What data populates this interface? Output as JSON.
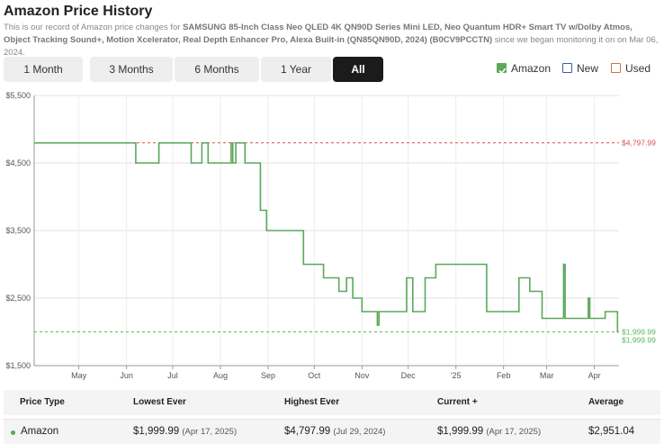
{
  "header": {
    "title": "Amazon Price History",
    "desc_prefix": "This is our record of Amazon price changes for ",
    "product_name": "SAMSUNG 85-Inch Class Neo QLED 4K QN90D Series Mini LED, Neo Quantum HDR+ Smart TV w/Dolby Atmos, Object Tracking Sound+, Motion Xcelerator, Real Depth Enhancer Pro, Alexa Built-in (QN85QN90D, 2024) (B0CV9PCCTN)",
    "desc_suffix": " since we began monitoring it on on Mar 06, 2024."
  },
  "tabs": [
    {
      "label": "1 Month",
      "active": false
    },
    {
      "label": "3 Months",
      "active": false
    },
    {
      "label": "6 Months",
      "active": false
    },
    {
      "label": "1 Year",
      "active": false
    },
    {
      "label": "All",
      "active": true
    }
  ],
  "legend": [
    {
      "label": "Amazon",
      "checked": true,
      "color": "#5ba85b"
    },
    {
      "label": "New",
      "checked": false,
      "color": "#3a5fb0"
    },
    {
      "label": "Used",
      "checked": false,
      "color": "#c8784a"
    }
  ],
  "chart_data": {
    "type": "line",
    "title": "",
    "xlabel": "",
    "ylabel": "",
    "ylim": [
      1500,
      5500
    ],
    "y_ticks": [
      "$1,500",
      "$2,500",
      "$3,500",
      "$4,500",
      "$5,500"
    ],
    "y_tick_values": [
      1500,
      2500,
      3500,
      4500,
      5500
    ],
    "x_ticks": [
      "May",
      "Jun",
      "Jul",
      "Aug",
      "Sep",
      "Oct",
      "Nov",
      "Dec",
      "'25",
      "Feb",
      "Mar",
      "Apr"
    ],
    "x_tick_values": [
      "2024-05-01",
      "2024-06-01",
      "2024-07-01",
      "2024-08-01",
      "2024-09-01",
      "2024-10-01",
      "2024-11-01",
      "2024-12-01",
      "2025-01-01",
      "2025-02-01",
      "2025-03-01",
      "2025-04-01"
    ],
    "x_range": [
      "2024-04-02",
      "2025-04-17"
    ],
    "grid": true,
    "highest_line": {
      "value": 4797.99,
      "label": "$4,797.99",
      "color": "#d9534f"
    },
    "lowest_line": {
      "value": 1999.99,
      "label": "$1,999.99",
      "color": "#5cb85c"
    },
    "current_label": "$1,999.99",
    "series": [
      {
        "name": "Amazon",
        "color": "#5ba85b",
        "step": true,
        "points": [
          [
            "2024-04-02",
            4797.99
          ],
          [
            "2024-06-07",
            4499.99
          ],
          [
            "2024-06-22",
            4797.99
          ],
          [
            "2024-07-13",
            4499.99
          ],
          [
            "2024-07-20",
            4797.99
          ],
          [
            "2024-07-24",
            4499.99
          ],
          [
            "2024-08-08",
            4797.99
          ],
          [
            "2024-08-09",
            4499.99
          ],
          [
            "2024-08-11",
            4797.99
          ],
          [
            "2024-08-17",
            4499.99
          ],
          [
            "2024-08-27",
            3799.99
          ],
          [
            "2024-08-31",
            3499.99
          ],
          [
            "2024-09-24",
            2999.99
          ],
          [
            "2024-10-07",
            2799.99
          ],
          [
            "2024-10-17",
            2599.99
          ],
          [
            "2024-10-22",
            2799.99
          ],
          [
            "2024-10-26",
            2499.99
          ],
          [
            "2024-11-01",
            2299.99
          ],
          [
            "2024-11-11",
            2099.99
          ],
          [
            "2024-11-12",
            2299.99
          ],
          [
            "2024-11-30",
            2799.99
          ],
          [
            "2024-12-04",
            2299.99
          ],
          [
            "2024-12-12",
            2799.99
          ],
          [
            "2024-12-19",
            2999.99
          ],
          [
            "2025-01-21",
            2299.99
          ],
          [
            "2025-02-11",
            2799.99
          ],
          [
            "2025-02-18",
            2599.99
          ],
          [
            "2025-02-26",
            2199.99
          ],
          [
            "2025-03-12",
            2999.99
          ],
          [
            "2025-03-13",
            2199.99
          ],
          [
            "2025-03-28",
            2499.99
          ],
          [
            "2025-03-29",
            2199.99
          ],
          [
            "2025-04-08",
            2299.99
          ],
          [
            "2025-04-16",
            1999.99
          ],
          [
            "2025-04-17",
            1999.99
          ]
        ]
      }
    ]
  },
  "table": {
    "headers": [
      "Price Type",
      "Lowest Ever",
      "Highest Ever",
      "Current +",
      "Average"
    ],
    "row": {
      "type": "Amazon",
      "lowest": "$1,999.99",
      "lowest_date": "(Apr 17, 2025)",
      "highest": "$4,797.99",
      "highest_date": "(Jul 29, 2024)",
      "current": "$1,999.99",
      "current_date": "(Apr 17, 2025)",
      "average": "$2,951.04"
    }
  }
}
